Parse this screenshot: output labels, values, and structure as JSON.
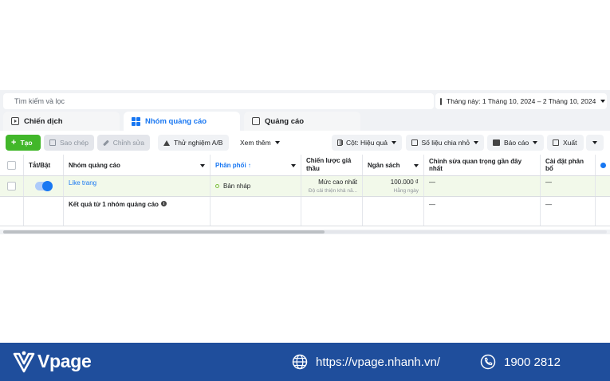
{
  "search": {
    "placeholder": "Tìm kiếm và lọc"
  },
  "date_range": {
    "label": "Tháng này: 1 Tháng 10, 2024 – 2 Tháng 10, 2024"
  },
  "tabs": [
    {
      "label": "Chiến dịch"
    },
    {
      "label": "Nhóm quảng cáo"
    },
    {
      "label": "Quảng cáo"
    }
  ],
  "toolbar": {
    "create": "Tạo",
    "duplicate": "Sao chép",
    "edit": "Chỉnh sửa",
    "ab_test": "Thử nghiệm A/B",
    "more": "Xem thêm",
    "columns": "Cột: Hiệu quả",
    "breakdown": "Số liệu chia nhỏ",
    "reports": "Báo cáo",
    "export": "Xuất"
  },
  "table": {
    "headers": {
      "onoff": "Tắt/Bật",
      "adset": "Nhóm quảng cáo",
      "delivery": "Phân phối ↑",
      "bid": "Chiến lược giá thầu",
      "budget": "Ngân sách",
      "last_edit": "Chỉnh sửa quan trọng gần đây nhất",
      "attribution": "Cài đặt phân bổ"
    },
    "row": {
      "name": "Like trang",
      "delivery": "Bản nháp",
      "bid_main": "Mức cao nhất",
      "bid_sub": "Độ cải thiện khả nă...",
      "budget_main": "100.000 ₫",
      "budget_sub": "Hằng ngày",
      "last_edit": "—",
      "attribution": "—"
    },
    "summary": {
      "label": "Kết quả từ 1 nhóm quảng cáo",
      "last_edit": "—",
      "attribution": "—"
    }
  },
  "footer": {
    "brand": "Vpage",
    "url": "https://vpage.nhanh.vn/",
    "phone": "1900 2812"
  }
}
